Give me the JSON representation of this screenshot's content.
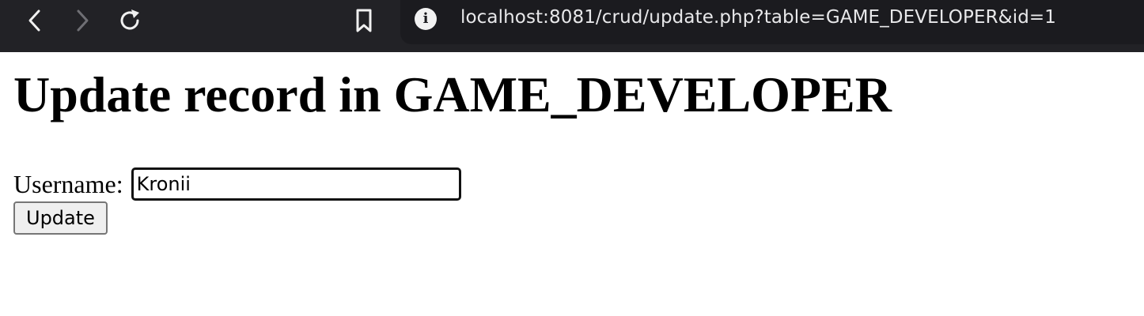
{
  "browser": {
    "url": "localhost:8081/crud/update.php?table=GAME_DEVELOPER&id=1",
    "icons": {
      "back": "chevron-left-icon",
      "forward": "chevron-right-icon",
      "reload": "reload-icon",
      "bookmark": "bookmark-icon",
      "info": "info-icon"
    },
    "info_glyph": "i"
  },
  "page": {
    "title": "Update record in GAME_DEVELOPER",
    "form": {
      "username_label": "Username:",
      "username_value": "Kronii",
      "submit_label": "Update"
    }
  }
}
